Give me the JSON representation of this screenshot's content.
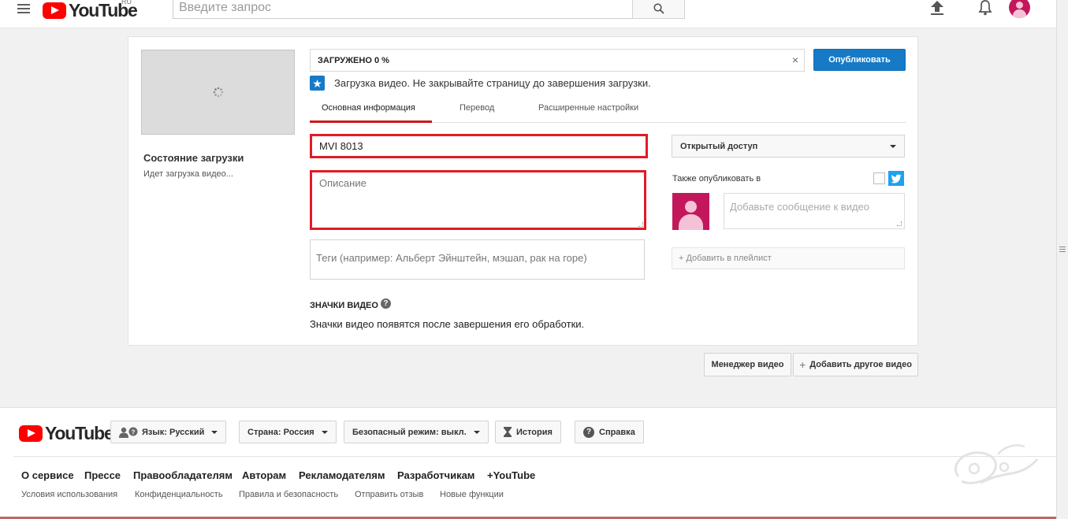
{
  "header": {
    "logo_text": "YouTube",
    "logo_region": "RU",
    "search_placeholder": "Введите запрос",
    "icons": [
      "menu-icon",
      "search-icon",
      "upload-icon",
      "bell-icon",
      "account-icon"
    ]
  },
  "upload": {
    "status_title": "Состояние загрузки",
    "status_text": "Идет загрузка видео...",
    "progress_label": "ЗАГРУЖЕНО 0 %",
    "progress_value": 0,
    "close_symbol": "×",
    "publish_label": "Опубликовать",
    "notice": "Загрузка видео. Не закрывайте страницу до завершения загрузки.",
    "tabs": [
      {
        "label": "Основная информация",
        "active": true
      },
      {
        "label": "Перевод",
        "active": false
      },
      {
        "label": "Расширенные настройки",
        "active": false
      }
    ],
    "title_value": "MVI 8013",
    "description_placeholder": "Описание",
    "tags_placeholder": "Теги (например: Альберт Эйнштейн, мэшап, рак на горе)",
    "thumbnails_label": "ЗНАЧКИ ВИДЕО",
    "thumbnails_help": "?",
    "thumbnails_text": "Значки видео появятся после завершения его обработки.",
    "privacy_value": "Открытый доступ",
    "also_publish_label": "Также опубликовать в",
    "share_placeholder": "Добавьте сообщение к видео",
    "playlist_label": "+ Добавить в плейлист",
    "highlight_color": "#e21a26",
    "accent_color": "#167ac6"
  },
  "actions": {
    "video_manager": "Менеджер видео",
    "add_another": "Добавить другое видео"
  },
  "footer": {
    "logo_text": "YouTube",
    "language": "Язык: Русский",
    "country": "Страна: Россия",
    "safe_mode": "Безопасный режим: выкл.",
    "history": "История",
    "help": "Справка",
    "links": [
      "О сервисе",
      "Прессе",
      "Правообладателям",
      "Авторам",
      "Рекламодателям",
      "Разработчикам",
      "+YouTube"
    ],
    "sublinks": [
      "Условия использования",
      "Конфиденциальность",
      "Правила и безопасность",
      "Отправить отзыв",
      "Новые функции"
    ]
  }
}
